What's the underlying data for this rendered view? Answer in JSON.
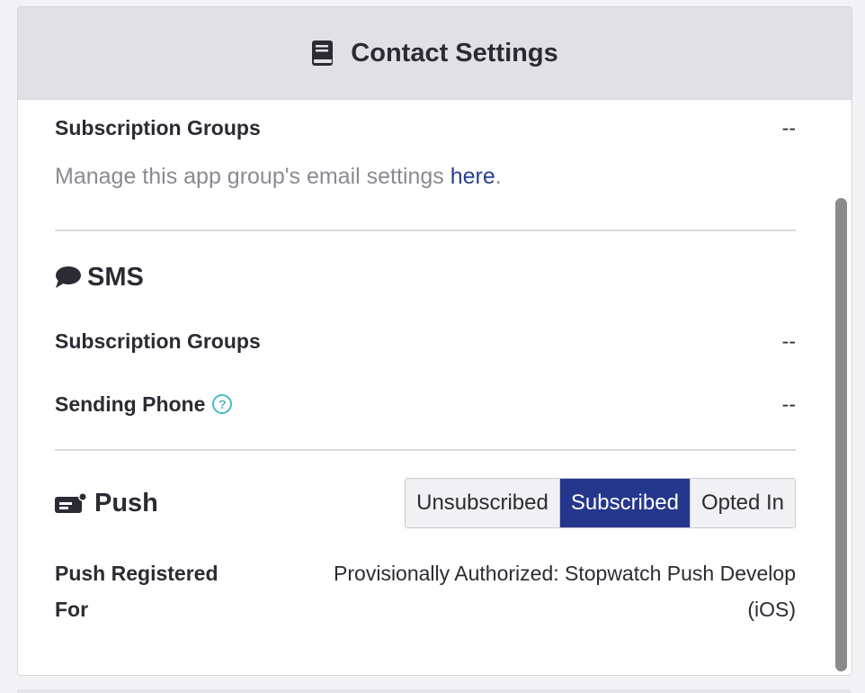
{
  "header": {
    "title": "Contact Settings",
    "icon": "book-icon"
  },
  "email": {
    "subscription_groups_label": "Subscription Groups",
    "subscription_groups_value": "--",
    "note_prefix": "Manage this app group's email settings ",
    "note_link": "here",
    "note_suffix": "."
  },
  "sms": {
    "title": "SMS",
    "icon": "chat-bubble-icon",
    "subscription_groups_label": "Subscription Groups",
    "subscription_groups_value": "--",
    "sending_phone_label": "Sending Phone",
    "help_glyph": "?",
    "sending_phone_value": "--"
  },
  "push": {
    "title": "Push",
    "icon": "push-card-icon",
    "options": [
      {
        "label": "Unsubscribed",
        "selected": false
      },
      {
        "label": "Subscribed",
        "selected": true
      },
      {
        "label": "Opted In",
        "selected": false
      }
    ],
    "registered_label_line1": "Push Registered",
    "registered_label_line2": "For",
    "registered_value_line1": "Provisionally Authorized: Stopwatch Push Develop",
    "registered_value_line2": "(iOS)"
  },
  "colors": {
    "accent": "#25378c",
    "link": "#2a3e8f",
    "help": "#4bb7c6",
    "header_bg": "#e0e0e5"
  }
}
